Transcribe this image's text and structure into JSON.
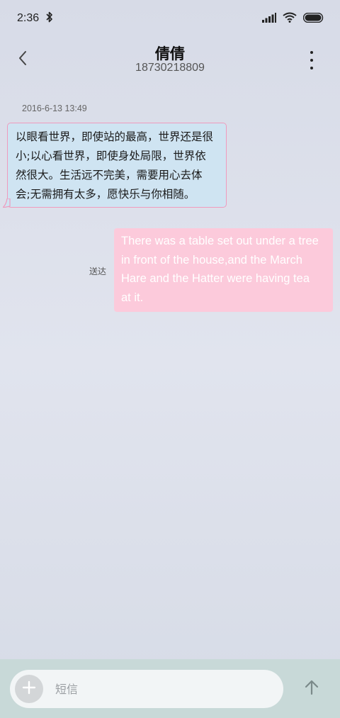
{
  "status_bar": {
    "time": "2:36",
    "icons": [
      "bluetooth-icon",
      "signal-icon",
      "wifi-icon",
      "battery-icon"
    ]
  },
  "header": {
    "contact_name": "倩倩",
    "contact_number": "18730218809",
    "back_icon": "chevron-left-icon",
    "more_icon": "more-vertical-icon"
  },
  "conversation": {
    "timestamp": "2016-6-13 13:49",
    "incoming_message": {
      "lines": [
        "以眼看世界，即使站的最高，世界还是很",
        "小;以心看世界，即使身处局限，世界依",
        "然很大。生活远不完美，需要用心去体",
        "会;无需拥有太多，愿快乐与你相随。"
      ]
    },
    "outgoing_message": {
      "status": "送达",
      "lines": [
        "There was a table set out under a tree",
        "in front of the house,and the March",
        "Hare and the Hatter were having tea",
        "at it."
      ]
    }
  },
  "composer": {
    "placeholder": "短信",
    "value": "",
    "add_icon": "plus-icon",
    "send_icon": "arrow-up-icon"
  },
  "colors": {
    "incoming_bubble": "#cfe4f2",
    "incoming_border": "#ef9bbd",
    "outgoing_bubble": "#fccadb",
    "composer_bar": "#c8d9d8"
  }
}
